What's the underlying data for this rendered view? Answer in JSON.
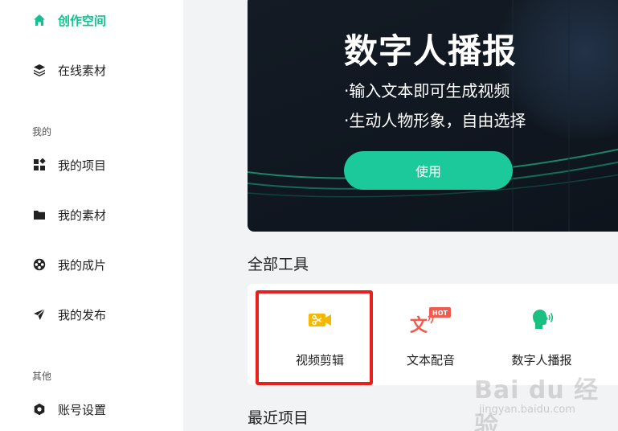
{
  "sidebar": {
    "items": [
      {
        "label": "创作空间",
        "icon": "home-icon",
        "active": true
      },
      {
        "label": "在线素材",
        "icon": "layers-icon"
      }
    ],
    "sections": [
      {
        "label": "我的",
        "items": [
          {
            "label": "我的项目",
            "icon": "grid-icon"
          },
          {
            "label": "我的素材",
            "icon": "folder-icon"
          },
          {
            "label": "我的成片",
            "icon": "film-reel-icon"
          },
          {
            "label": "我的发布",
            "icon": "send-icon"
          }
        ]
      },
      {
        "label": "其他",
        "items": [
          {
            "label": "账号设置",
            "icon": "hexagon-settings-icon"
          }
        ]
      }
    ]
  },
  "banner": {
    "title": "数字人播报",
    "line1": "·输入文本即可生成视频",
    "line2": "·生动人物形象，自由选择",
    "button_label": "使用"
  },
  "tools": {
    "heading": "全部工具",
    "items": [
      {
        "label": "视频剪辑",
        "icon": "video-edit-icon"
      },
      {
        "label": "文本配音",
        "icon": "text-dub-icon",
        "badge": "HOT"
      },
      {
        "label": "数字人播报",
        "icon": "digital-human-icon"
      }
    ]
  },
  "recent": {
    "heading": "最近项目"
  },
  "watermark": {
    "text": "Bai du 经验",
    "sub": "jingyan.baidu.com"
  },
  "colors": {
    "accent": "#13c08f",
    "button": "#1cc99a",
    "highlight": "#e8201c",
    "banner_bg": "#101720",
    "hot_badge": "#f05b4f",
    "video_icon": "#f5b800"
  }
}
